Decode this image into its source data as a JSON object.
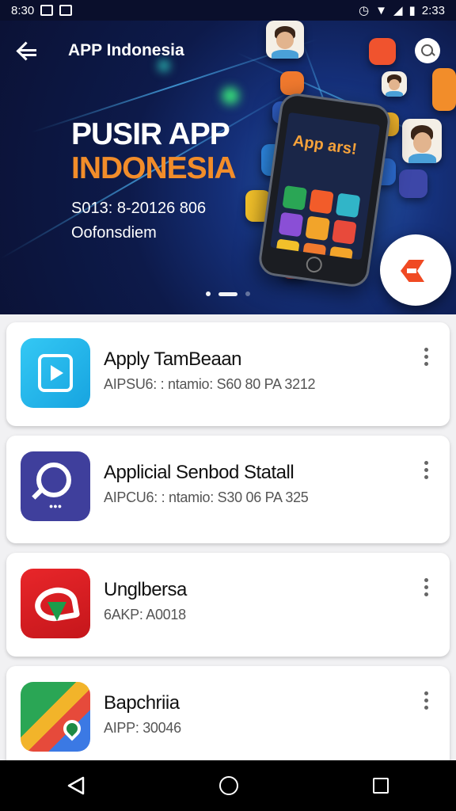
{
  "status_bar": {
    "time_left": "8:30",
    "time_right": "2:33"
  },
  "app_bar": {
    "title": "APP Indonesia"
  },
  "hero": {
    "title_line1": "PUSIR APP",
    "title_line2": "INDONESIA",
    "meta_line1": "S013: 8-20126 806",
    "meta_line2": "Oofonsdiem",
    "phone_heading": "App ars!",
    "carousel": {
      "count": 3,
      "active_index": 1
    }
  },
  "apps": [
    {
      "name": "Apply TamBeaan",
      "meta": "AIPSU6: : ntamio: S60 80 PA 3212",
      "icon": "play-tile-icon",
      "color": "#1fb3ea"
    },
    {
      "name": "Applicial Senbod Statall",
      "meta": "AIPCU6: : ntamio: S30 06 PA 325",
      "icon": "chat-search-icon",
      "color": "#3f3f9c"
    },
    {
      "name": "Unglbersa",
      "meta": "6AKP: A0018",
      "icon": "heart-arrow-icon",
      "color": "#d51f23"
    },
    {
      "name": "Bapchriia",
      "meta": "AIPP: 30046",
      "icon": "map-pin-icon",
      "color": "#2aa655"
    }
  ],
  "nav_bar": {
    "back": "back-triangle-icon",
    "home": "home-circle-icon",
    "recents": "recents-square-icon"
  }
}
